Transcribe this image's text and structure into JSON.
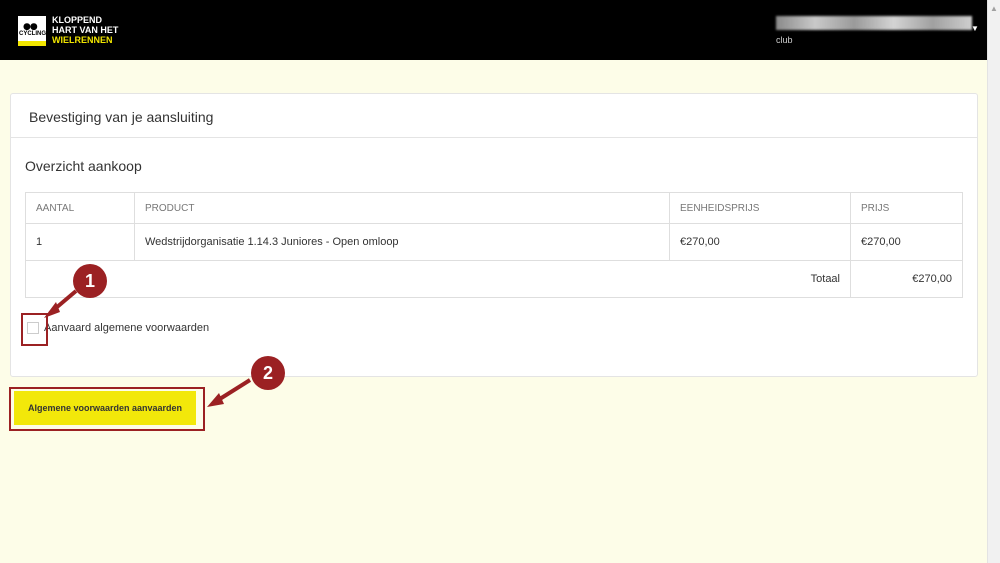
{
  "header": {
    "logo_line1": "KLOPPEND",
    "logo_line2": "HART VAN HET",
    "logo_line3": "WIELRENNEN",
    "logo_badge": "CYCLING",
    "user_role": "club"
  },
  "panel": {
    "title": "Bevestiging van je aansluiting",
    "section_title": "Overzicht aankoop"
  },
  "table": {
    "headers": [
      "AANTAL",
      "PRODUCT",
      "EENHEIDSPRIJS",
      "PRIJS"
    ],
    "rows": [
      [
        "1",
        "Wedstrijdorganisatie 1.14.3 Juniores - Open omloop",
        "€270,00",
        "€270,00"
      ]
    ],
    "total_label": "Totaal",
    "total_value": "€270,00"
  },
  "terms": {
    "checkbox_label": "Aanvaard algemene voorwaarden",
    "checked": false
  },
  "actions": {
    "accept_label": "Algemene voorwaarden aanvaarden"
  },
  "annotations": {
    "step1": "1",
    "step2": "2"
  },
  "colors": {
    "accent_yellow": "#f2e80a",
    "annotation_red": "#9b2123",
    "page_background": "#fdfde8"
  }
}
